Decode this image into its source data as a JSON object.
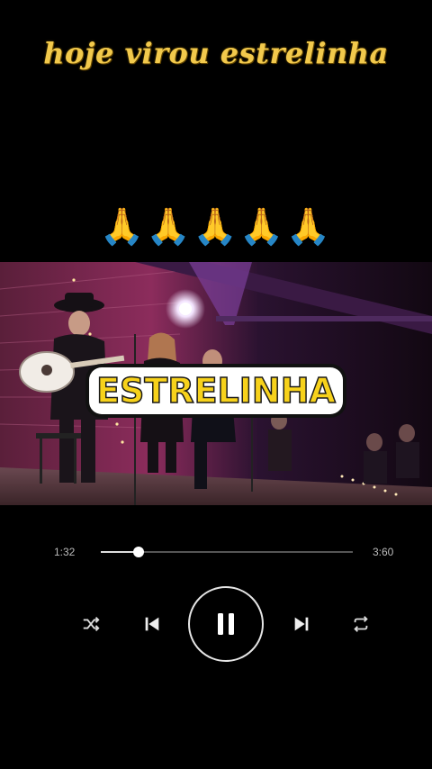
{
  "caption": "hoje virou estrelinha",
  "emojis": "🙏🙏🙏🙏🙏",
  "video": {
    "title_overlay": "ESTRELINHA"
  },
  "player": {
    "current_time": "1:32",
    "total_time": "3:60",
    "progress_fraction": 0.15,
    "state": "playing"
  },
  "controls": {
    "shuffle_icon": "shuffle-icon",
    "prev_icon": "skip-previous-icon",
    "play_pause_icon": "pause-icon",
    "next_icon": "skip-next-icon",
    "repeat_icon": "repeat-icon"
  },
  "colors": {
    "caption": "#f2c94c",
    "title_text": "#f7d21b",
    "background": "#000000",
    "stage_pink": "#c4457f"
  }
}
